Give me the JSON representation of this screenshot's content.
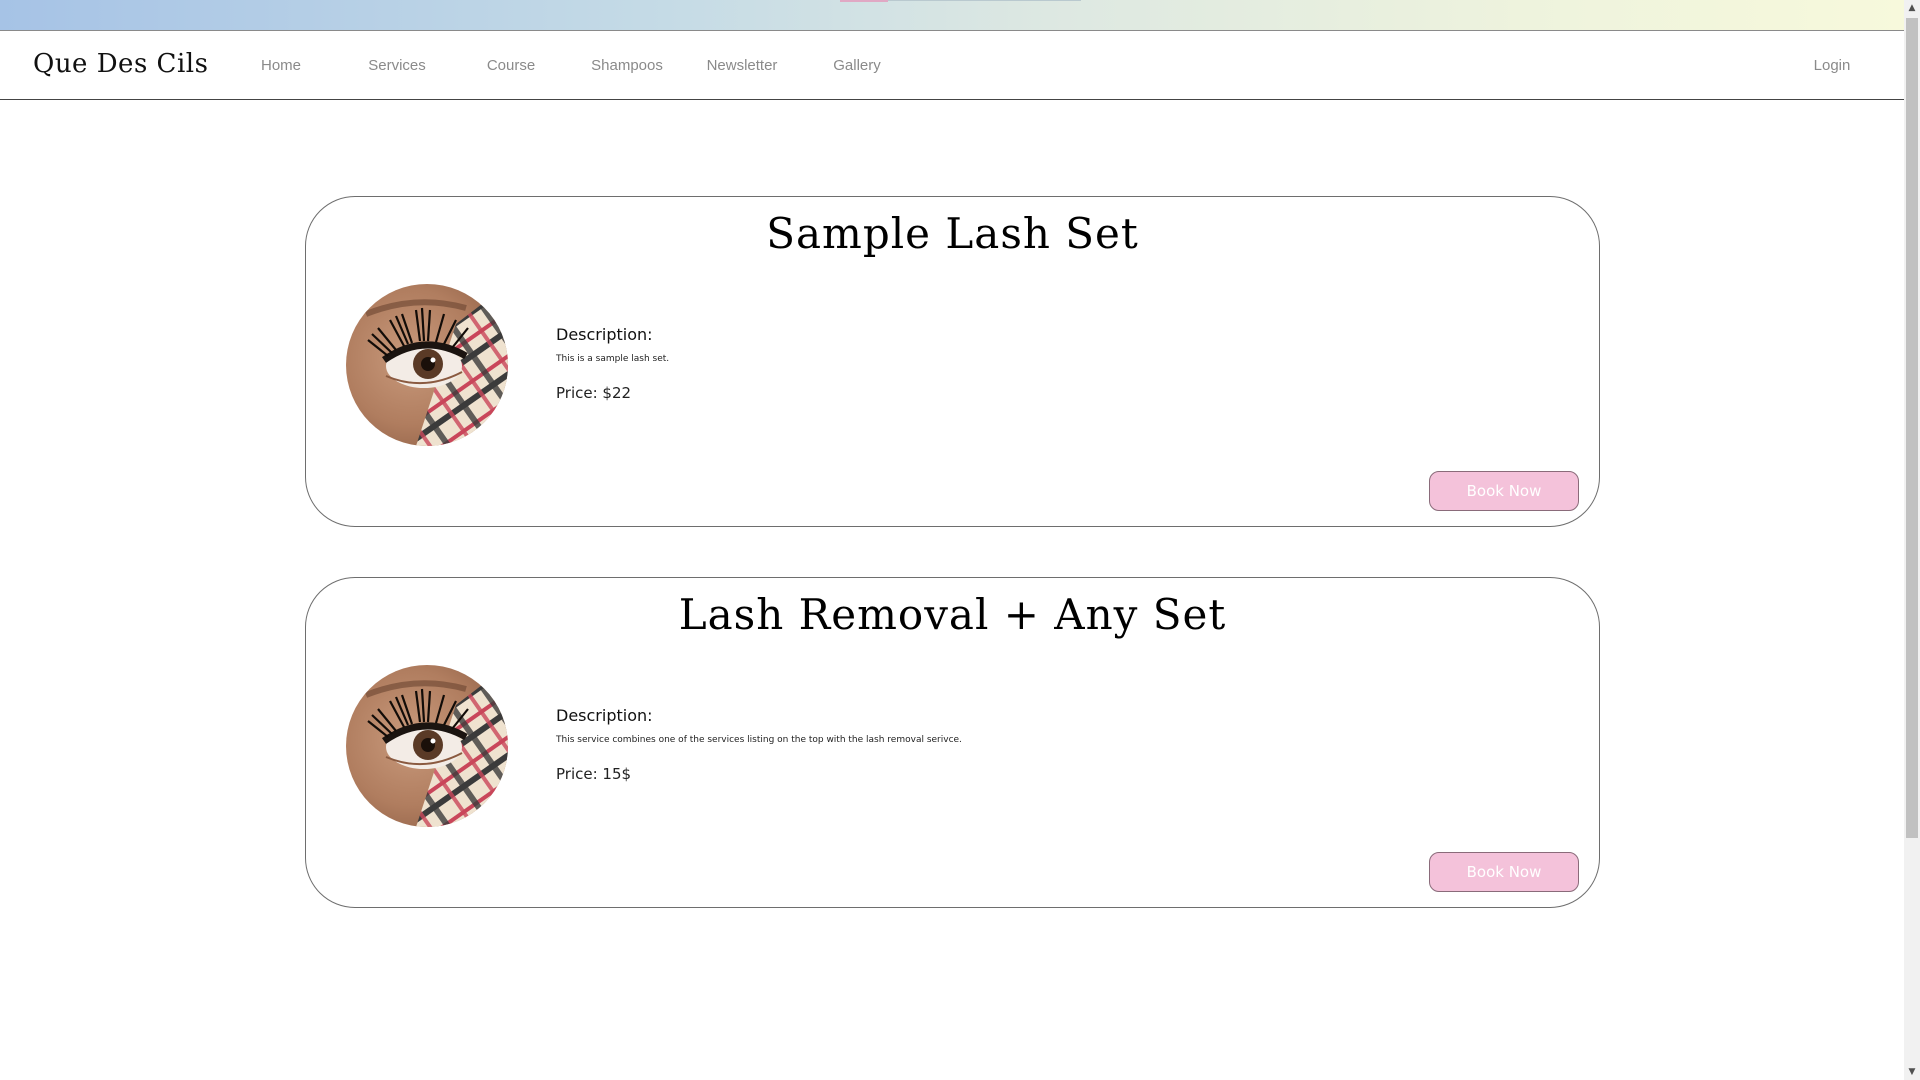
{
  "header": {
    "brand": "Que Des Cils",
    "nav": [
      {
        "label": "Home"
      },
      {
        "label": "Services"
      },
      {
        "label": "Course"
      },
      {
        "label": "Shampoos"
      },
      {
        "label": "Newsletter"
      },
      {
        "label": "Gallery"
      }
    ],
    "login": "Login"
  },
  "services": [
    {
      "title": "Sample Lash Set",
      "description_label": "Description:",
      "description": "This is a sample lash set.",
      "price": "Price: $22",
      "button": "Book Now"
    },
    {
      "title": "Lash Removal + Any Set",
      "description_label": "Description:",
      "description": "This service combines one of the services listing on the top with the lash removal serivce.",
      "price": "Price: 15$",
      "button": "Book Now"
    }
  ],
  "colors": {
    "button_bg": "#f4c2da",
    "topbar_start": "#a6c3e6",
    "topbar_end": "#f7f9dc"
  }
}
